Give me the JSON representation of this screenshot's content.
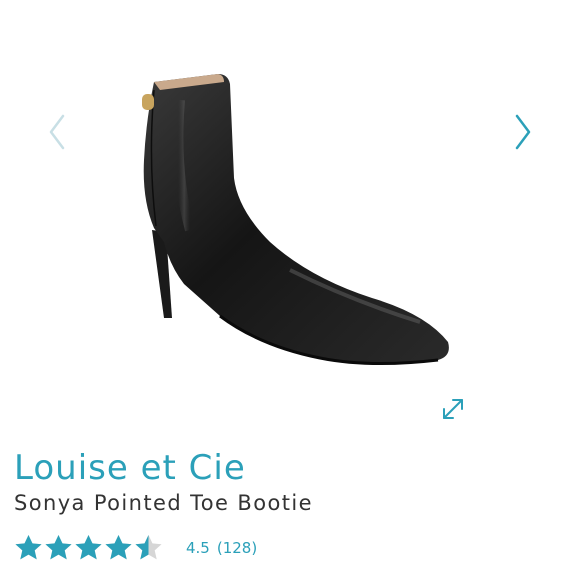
{
  "gallery": {
    "image_alt": "black leather pointed toe ankle bootie",
    "prev_icon": "chevron-left-icon",
    "next_icon": "chevron-right-icon",
    "expand_icon": "expand-icon"
  },
  "product": {
    "brand": "Louise et Cie",
    "name": "Sonya Pointed Toe Bootie"
  },
  "rating": {
    "value": 4.5,
    "max": 5,
    "value_label": "4.5",
    "count_label": "(128)"
  },
  "colors": {
    "accent": "#2ba0b9",
    "arrow_inactive": "#c8dfe5",
    "star_empty": "#d6d6d6",
    "text": "#333333"
  }
}
